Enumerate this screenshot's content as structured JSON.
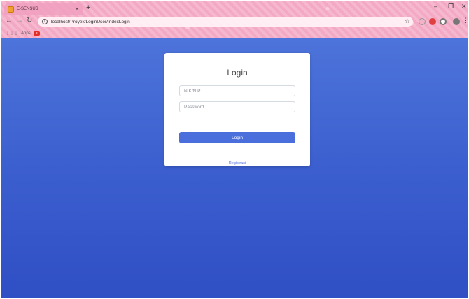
{
  "browser": {
    "tab_title": "E-SENSUS",
    "url": "localhost/Proyek/LoginUser/IndexLogin",
    "bookmarks": {
      "apps_label": "Apps"
    },
    "icons": {
      "favicon": "page-favicon",
      "back": "back-arrow-icon",
      "forward": "forward-arrow-icon",
      "reload": "reload-icon",
      "info": "info-icon",
      "star": "star-icon"
    }
  },
  "login": {
    "title": "Login",
    "nik_placeholder": "NIK/NIP",
    "password_placeholder": "Password",
    "login_button": "Login",
    "register_link": "Registrasi"
  },
  "colors": {
    "page_gradient_top": "#4d74da",
    "page_gradient_bottom": "#2f4fc4",
    "button": "#4a6fdc",
    "link": "#4e73df",
    "chrome": "#f4b2c9"
  }
}
